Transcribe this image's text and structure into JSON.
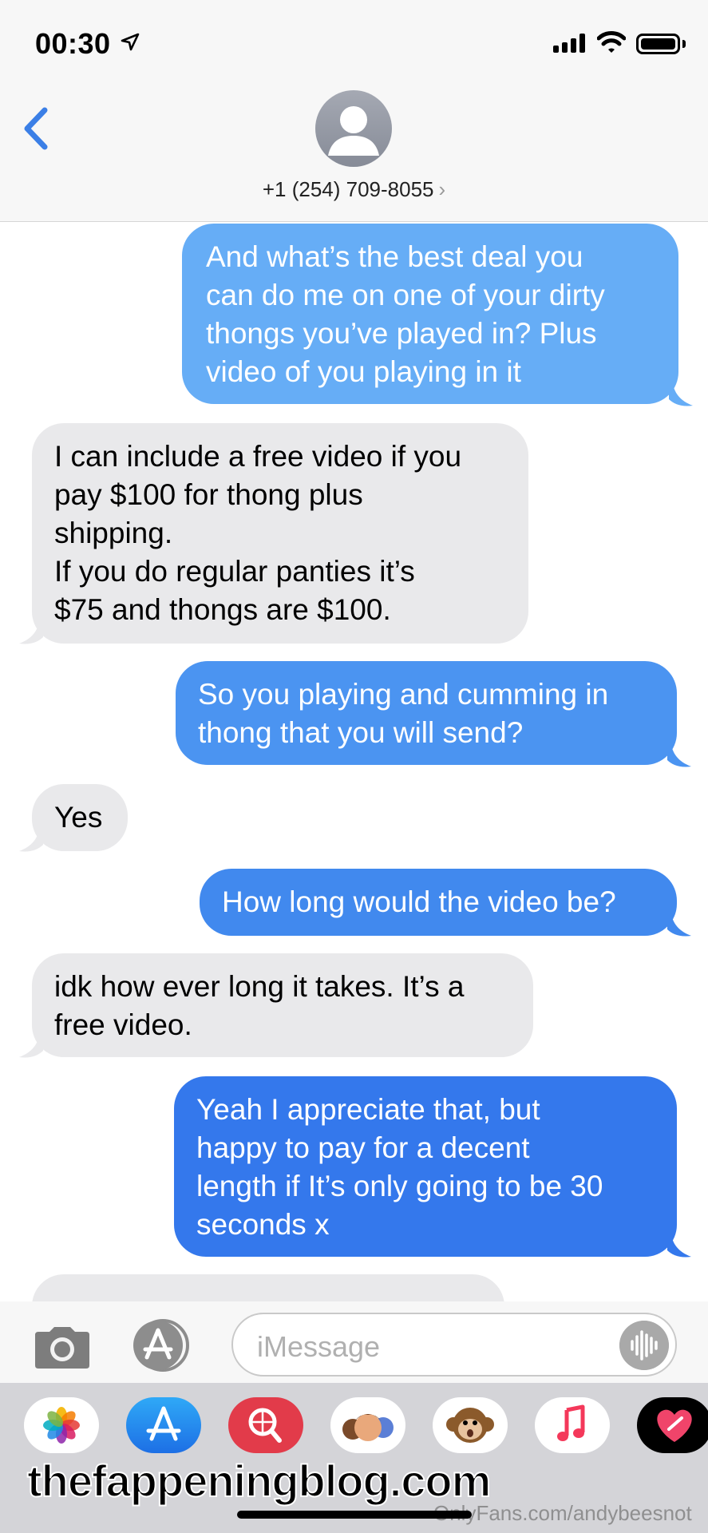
{
  "status_bar": {
    "time": "00:30"
  },
  "header": {
    "contact": "+1 (254) 709-8055",
    "contact_chevron": "›"
  },
  "messages": [
    {
      "direction": "out",
      "text": "And what’s the best deal you\ncan do me on one of your dirty\nthongs you’ve played  in? Plus\nvideo of you playing in it"
    },
    {
      "direction": "in",
      "text": "I can include a free video if you\npay $100 for thong plus\nshipping.\nIf you do regular panties it’s\n$75 and thongs are $100."
    },
    {
      "direction": "out",
      "text": "So you playing and cumming in\nthong that you will send?"
    },
    {
      "direction": "in",
      "text": "Yes"
    },
    {
      "direction": "out",
      "text": "How long would the video be?"
    },
    {
      "direction": "in",
      "text": "idk how ever long it takes. It’s a\nfree video."
    },
    {
      "direction": "out",
      "text": "Yeah I appreciate that, but\nhappy to pay for a decent\nlength if It’s only going to be 30\nseconds x"
    }
  ],
  "input": {
    "placeholder": "iMessage"
  },
  "app_drawer": {
    "apps": [
      "photos-icon",
      "app-store-icon",
      "web-search-icon",
      "memoji-icon",
      "animoji-monkey-icon",
      "music-icon",
      "digital-touch-icon"
    ]
  },
  "overlay": {
    "watermark": "thefappeningblog.com",
    "onlyfans_watermark": "OnlyFans.com/andybeesnot"
  },
  "colors": {
    "outgoing_top": "#6bb3f7",
    "outgoing_bottom": "#2f73ec",
    "incoming": "#e9e9eb",
    "ios_blue": "#3b7fe6"
  }
}
